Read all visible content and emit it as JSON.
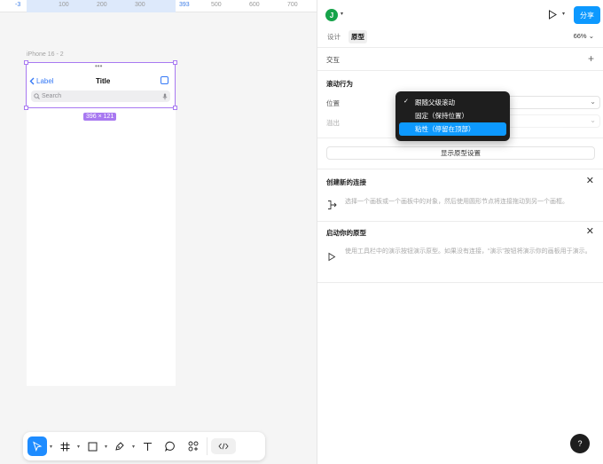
{
  "ruler": {
    "ticks": [
      {
        "label": "-3",
        "highlight": true
      },
      {
        "label": "100",
        "highlight": false
      },
      {
        "label": "200",
        "highlight": false
      },
      {
        "label": "300",
        "highlight": false
      },
      {
        "label": "393",
        "highlight": true
      },
      {
        "label": "500",
        "highlight": false
      },
      {
        "label": "600",
        "highlight": false
      },
      {
        "label": "700",
        "highlight": false
      }
    ]
  },
  "canvas": {
    "frame_label": "iPhone 16 - 2",
    "nav_back_label": "Label",
    "nav_title": "Title",
    "search_placeholder": "Search",
    "size_badge": "396 × 121"
  },
  "toolbar": {
    "items": [
      "move-icon",
      "frame-icon",
      "shape-icon",
      "pen-icon",
      "text-icon",
      "comment-icon",
      "components-icon"
    ],
    "code_icon": "code-icon"
  },
  "panel": {
    "avatar_letter": "J",
    "share_label": "分享",
    "tabs": [
      {
        "label": "设计",
        "active": false
      },
      {
        "label": "原型",
        "active": true
      }
    ],
    "zoom": "66%",
    "interaction_title": "交互",
    "scroll_title": "滚动行为",
    "position_label": "位置",
    "overflow_label": "溢出",
    "show_proto_settings": "显示原型设置",
    "create_connection": {
      "title": "创建新的连接",
      "text": "选择一个画板或一个画板中的对象，然后使用圆形节点将连接拖动到另一个画框。"
    },
    "start_prototype": {
      "title": "启动你的原型",
      "text": "使用工具栏中的演示按钮演示原型。如果没有连接，“演示”按钮将演示你的画板用于演示。"
    }
  },
  "dropdown": {
    "options": [
      {
        "label": "跟随父级滚动",
        "checked": true,
        "highlighted": false
      },
      {
        "label": "固定（保持位置）",
        "checked": false,
        "highlighted": false
      },
      {
        "label": "粘性（停留在顶部）",
        "checked": false,
        "highlighted": true
      }
    ]
  },
  "help_label": "?",
  "colors": {
    "accent": "#0d99ff",
    "selection": "#a879f1",
    "ios_blue": "#3478f6"
  }
}
